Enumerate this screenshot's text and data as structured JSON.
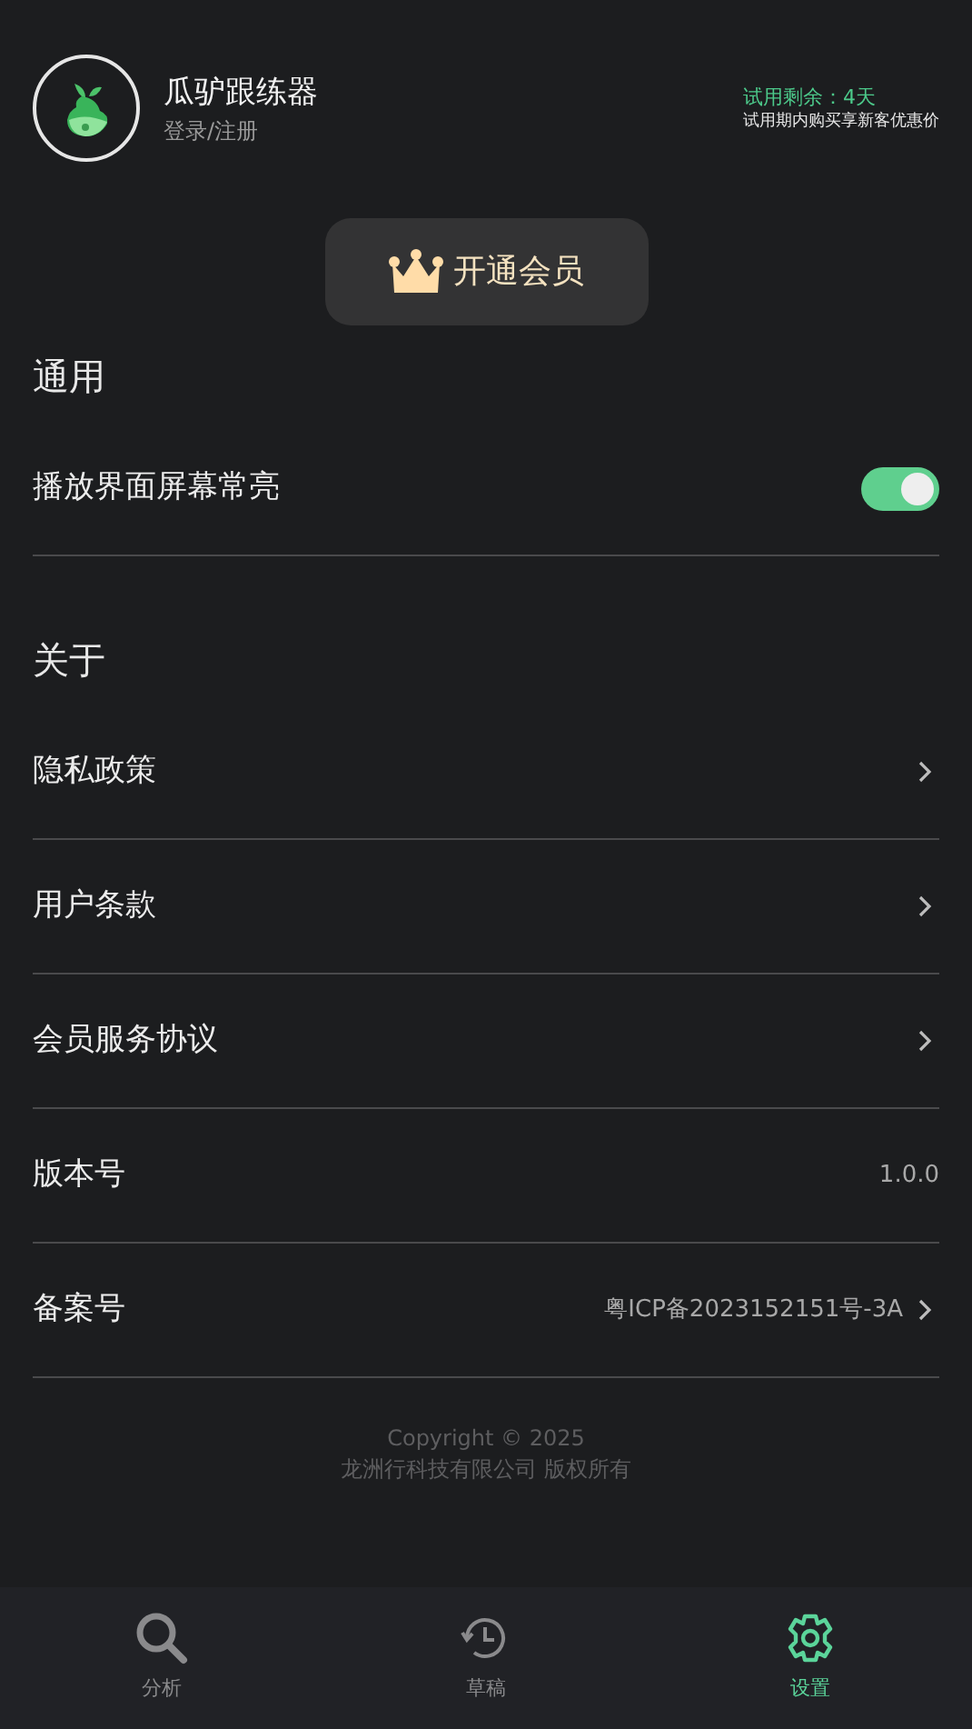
{
  "profile": {
    "app_name": "瓜驴跟练器",
    "login": "登录/注册",
    "trial_remaining": "试用剩余：4天",
    "trial_offer": "试用期内购买享新客优惠价"
  },
  "member_button": "开通会员",
  "sections": [
    {
      "title": "通用",
      "items": [
        {
          "kind": "toggle",
          "label": "播放界面屏幕常亮",
          "on": true
        }
      ]
    },
    {
      "title": "关于",
      "items": [
        {
          "kind": "link",
          "label": "隐私政策"
        },
        {
          "kind": "link",
          "label": "用户条款"
        },
        {
          "kind": "link",
          "label": "会员服务协议"
        },
        {
          "kind": "value",
          "label": "版本号",
          "value": "1.0.0"
        },
        {
          "kind": "value_link",
          "label": "备案号",
          "value": "粤ICP备2023152151号-3A"
        }
      ]
    }
  ],
  "footer": [
    "Copyright © 2025",
    "龙洲行科技有限公司 版权所有"
  ],
  "nav": [
    {
      "kind": "search",
      "label": "分析",
      "selected": false
    },
    {
      "kind": "history",
      "label": "草稿",
      "selected": false
    },
    {
      "kind": "settings",
      "label": "设置",
      "selected": true
    }
  ]
}
